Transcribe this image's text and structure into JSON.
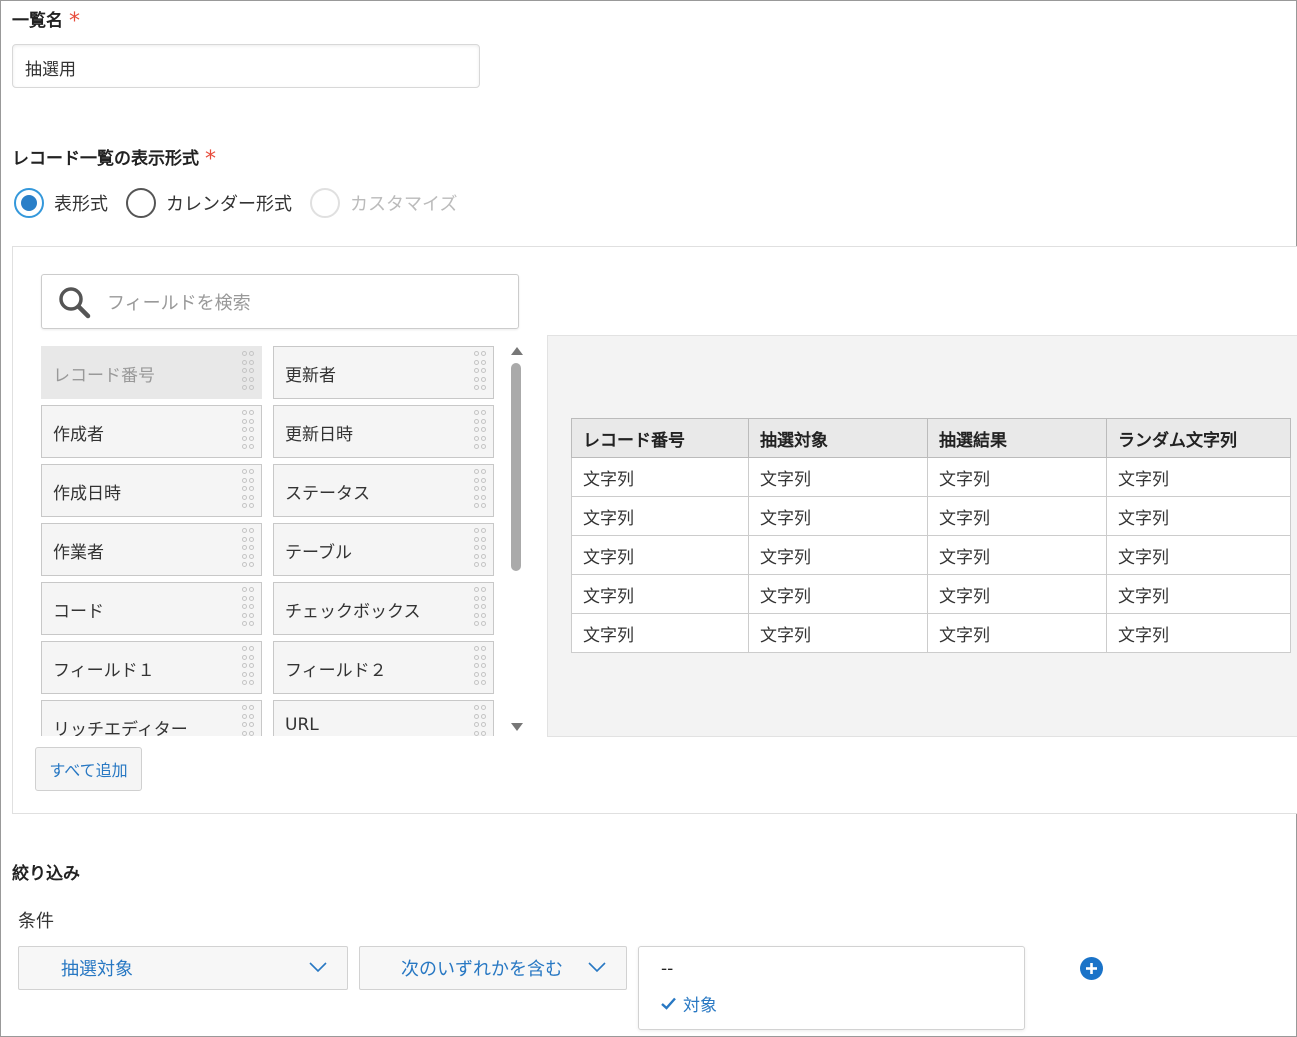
{
  "list_name": {
    "label": "一覧名",
    "required_mark": "*",
    "value": "抽選用"
  },
  "display_format": {
    "label": "レコード一覧の表示形式",
    "required_mark": "*",
    "options": [
      {
        "label": "表形式",
        "checked": true,
        "disabled": false
      },
      {
        "label": "カレンダー形式",
        "checked": false,
        "disabled": false
      },
      {
        "label": "カスタマイズ",
        "checked": false,
        "disabled": true
      }
    ]
  },
  "field_search": {
    "placeholder": "フィールドを検索"
  },
  "fields": [
    {
      "label": "レコード番号",
      "disabled": true
    },
    {
      "label": "更新者",
      "disabled": false
    },
    {
      "label": "作成者",
      "disabled": false
    },
    {
      "label": "更新日時",
      "disabled": false
    },
    {
      "label": "作成日時",
      "disabled": false
    },
    {
      "label": "ステータス",
      "disabled": false
    },
    {
      "label": "作業者",
      "disabled": false
    },
    {
      "label": "テーブル",
      "disabled": false
    },
    {
      "label": "コード",
      "disabled": false
    },
    {
      "label": "チェックボックス",
      "disabled": false
    },
    {
      "label": "フィールド１",
      "disabled": false
    },
    {
      "label": "フィールド２",
      "disabled": false
    },
    {
      "label": "リッチエディター",
      "disabled": false
    },
    {
      "label": "URL",
      "disabled": false
    }
  ],
  "add_all_label": "すべて追加",
  "preview_table": {
    "headers": [
      "レコード番号",
      "抽選対象",
      "抽選結果",
      "ランダム文字列"
    ],
    "rows": [
      [
        "文字列",
        "文字列",
        "文字列",
        "文字列"
      ],
      [
        "文字列",
        "文字列",
        "文字列",
        "文字列"
      ],
      [
        "文字列",
        "文字列",
        "文字列",
        "文字列"
      ],
      [
        "文字列",
        "文字列",
        "文字列",
        "文字列"
      ],
      [
        "文字列",
        "文字列",
        "文字列",
        "文字列"
      ]
    ]
  },
  "filter": {
    "title": "絞り込み",
    "condition_label": "条件",
    "field_select": "抽選対象",
    "operator_select": "次のいずれかを含む",
    "values": [
      {
        "label": "--",
        "selected": false
      },
      {
        "label": "対象",
        "selected": true
      }
    ]
  },
  "colors": {
    "accent": "#2878c3",
    "required": "#e74c3c",
    "radio_checked": "#2a7fc8"
  },
  "icons": {
    "search": "search-icon",
    "grip": "drag-handle-icon",
    "chevron": "chevron-down-icon",
    "check": "check-icon",
    "add": "plus-circle-icon"
  }
}
